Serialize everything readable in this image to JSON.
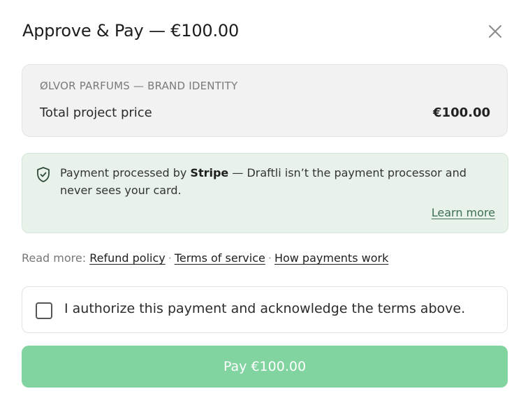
{
  "modal": {
    "title": "Approve & Pay — €100.00",
    "close_icon": "close-icon"
  },
  "summary": {
    "project_name": "ØLVOR PARFUMS — BRAND IDENTITY",
    "price_label": "Total project price",
    "price_value": "€100.00"
  },
  "notice": {
    "icon": "shield-check-icon",
    "text_before": "Payment processed by ",
    "processor": "Stripe",
    "text_after": " — Draftli isn’t the payment processor and never sees your card.",
    "learn_more": "Learn more"
  },
  "links": {
    "prefix": "Read more:",
    "separator": "·",
    "items": [
      "Refund policy",
      "Terms of service",
      "How payments work"
    ]
  },
  "consent": {
    "checked": false,
    "label": "I authorize this payment and acknowledge the terms above."
  },
  "pay_button": {
    "label": "Pay €100.00",
    "enabled": false,
    "color": "#81d39f"
  },
  "colors": {
    "notice_bg": "#e8f2ea",
    "summary_bg": "#f2f2f2",
    "link_accent": "#3d6f52"
  }
}
